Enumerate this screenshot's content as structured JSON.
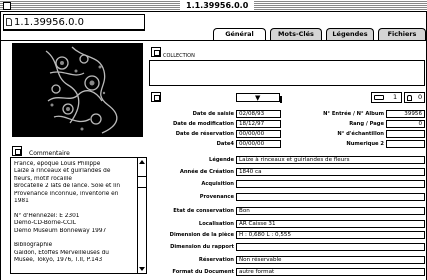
{
  "window": {
    "title": "1.1.39956.0.0"
  },
  "record": {
    "number": "1.1.39956.0.0"
  },
  "tabs": [
    {
      "label": "Général",
      "active": true
    },
    {
      "label": "Mots-Clés",
      "active": false
    },
    {
      "label": "Légendes",
      "active": false
    },
    {
      "label": "Fichiers",
      "active": false
    }
  ],
  "collection": {
    "label": "COLLECTION",
    "value": ""
  },
  "counters": {
    "image_count": "1",
    "lock_count": "0"
  },
  "dates": {
    "saisie_label": "Date de saisie",
    "saisie": "02/08/93",
    "modif_label": "Date de modification",
    "modif": "18/12/97",
    "reservation_label": "Date de réservation",
    "reservation": "00/00/00",
    "date4_label": "Date4",
    "date4": "00/00/00"
  },
  "numbers": {
    "entree_label": "N° Entrée / N° Album",
    "entree": "39956",
    "rang_label": "Rang / Page",
    "rang": "0",
    "echantillon_label": "N° d'échantillon",
    "echantillon": "",
    "numerique_label": "Numerique 2",
    "numerique": ""
  },
  "fields": [
    {
      "label": "Légende",
      "value": "Laize à rinceaux et guirlandes de fleurs"
    },
    {
      "label": "Année de Création",
      "value": "1840 ca"
    },
    {
      "label": "Acquisition",
      "value": ""
    },
    {
      "label": "Provenance",
      "value": ""
    },
    {
      "label": "Etat de conservation",
      "value": "Bon"
    },
    {
      "label": "Localisation",
      "value": "AR Caisse 31"
    },
    {
      "label": "Dimension de la pièce",
      "value": "H : 0,680 L : 0,555"
    },
    {
      "label": "Dimension du rapport",
      "value": ""
    },
    {
      "label": "Réservation",
      "value": "Non réservable"
    },
    {
      "label": "Format du Document",
      "value": "autre format"
    }
  ],
  "commentaire": {
    "label": "Commentaire",
    "lines": [
      "France, époque Louis Philippe",
      "Laize à rinceaux et guirlandes de",
      "fleurs, motif rocaille",
      "Brocatelle 2 lats de lancé. Soie et lin",
      "Provenance inconnue, inventorié en",
      "1981",
      "",
      "N° d'Hennezel: E 2301",
      "Démo-CD-Borne-CCIL",
      "Démo Muséum Bonneway 1997",
      "",
      "Bibliographie",
      "Gaidon, Etoffes Merveilleuses du",
      "Musée, Tokyo, 1976, T.II, P.143"
    ]
  },
  "icons": {
    "close": "close-box-icon",
    "record": "document-icon",
    "collection": "note-icon",
    "blank": "page-icon",
    "camera": "camera-icon",
    "lock": "lock-icon",
    "comment": "note-icon"
  }
}
